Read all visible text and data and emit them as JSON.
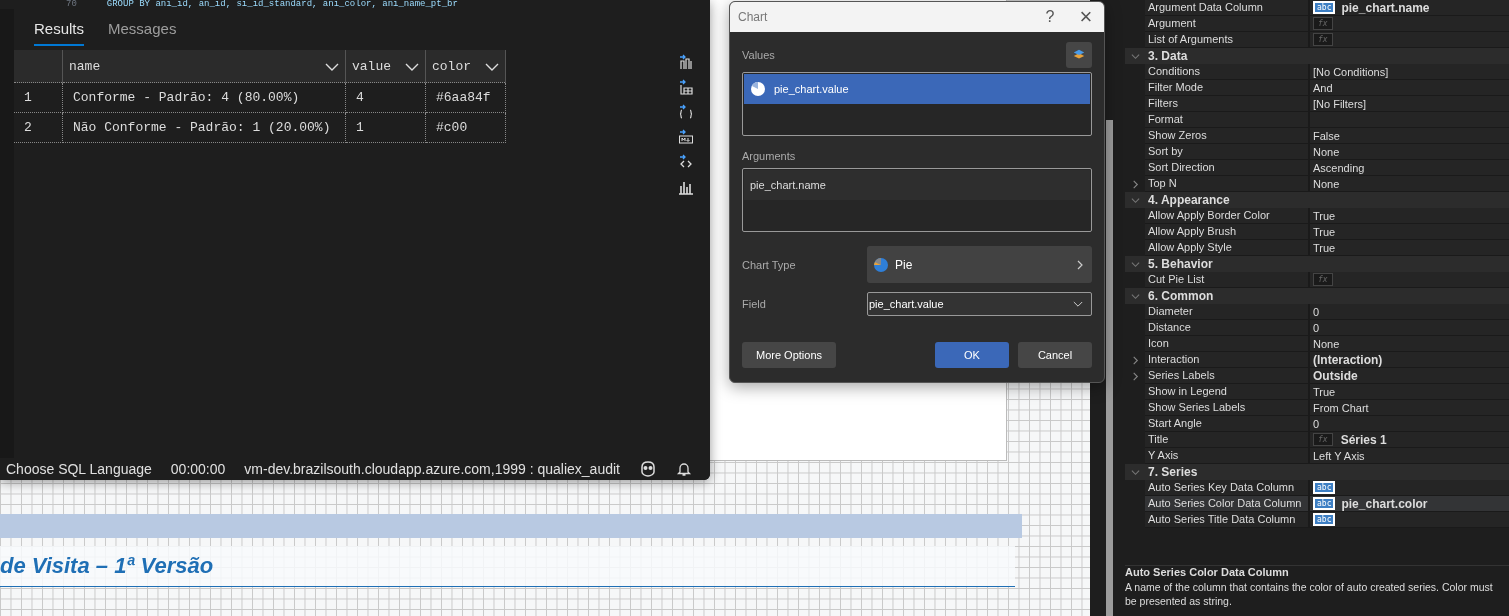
{
  "editor": {
    "line_number": "70",
    "code": "GROUP BY ani_id, an_id, si_id_standard, ani_color, ani_name_pt_br"
  },
  "results": {
    "tabs": [
      {
        "label": "Results",
        "selected": true
      },
      {
        "label": "Messages",
        "selected": false
      }
    ],
    "columns": [
      "name",
      "value",
      "color"
    ],
    "rows": [
      {
        "number": "1",
        "cells": [
          "Conforme - Padrão: 4 (80.00%)",
          "4",
          "#6aa84f"
        ]
      },
      {
        "number": "2",
        "cells": [
          "Não Conforme - Padrão: 1 (20.00%)",
          "1",
          "#c00"
        ]
      }
    ]
  },
  "status_bar": {
    "language": "Choose SQL Language",
    "elapsed": "00:00:00",
    "connection": "vm-dev.brazilsouth.cloudapp.azure.com,1999 : qualiex_audit"
  },
  "designer": {
    "title": "de Visita – 1ª Versão"
  },
  "dialog": {
    "title": "Chart",
    "help": "?",
    "close": "×",
    "values_label": "Values",
    "values": [
      {
        "label": "pie_chart.value",
        "selected": true
      }
    ],
    "arguments_label": "Arguments",
    "arguments": [
      {
        "label": "pie_chart.name",
        "selected": false
      }
    ],
    "chart_type_label": "Chart Type",
    "chart_type": "Pie",
    "field_label": "Field",
    "field": "pie_chart.value",
    "buttons": [
      {
        "label": "More Options",
        "kind": "secondary"
      },
      {
        "label": "OK",
        "kind": "primary"
      },
      {
        "label": "Cancel",
        "kind": "secondary"
      }
    ]
  },
  "properties": {
    "rows": [
      {
        "kind": "property",
        "name": "Argument Data Column",
        "editor": "abc",
        "value": "pie_chart.name",
        "bold": true,
        "selected": false
      },
      {
        "kind": "property",
        "name": "Argument",
        "editor": "fx",
        "selected": false
      },
      {
        "kind": "property",
        "name": "List of Arguments",
        "editor": "fx",
        "selected": false
      },
      {
        "kind": "category",
        "name": "3. Data",
        "expanded": true
      },
      {
        "kind": "property",
        "name": "Conditions",
        "value": "[No Conditions]",
        "bold": false,
        "selected": false
      },
      {
        "kind": "property",
        "name": "Filter Mode",
        "value": "And",
        "bold": false,
        "selected": false
      },
      {
        "kind": "property",
        "name": "Filters",
        "value": "[No Filters]",
        "bold": false,
        "selected": false
      },
      {
        "kind": "property",
        "name": "Format",
        "selected": false
      },
      {
        "kind": "property",
        "name": "Show Zeros",
        "value": "False",
        "bold": false,
        "selected": false
      },
      {
        "kind": "property",
        "name": "Sort by",
        "value": "None",
        "bold": false,
        "selected": false
      },
      {
        "kind": "property",
        "name": "Sort Direction",
        "value": "Ascending",
        "bold": false,
        "selected": false
      },
      {
        "kind": "expandable",
        "name": "Top N",
        "value": "None",
        "bold": false,
        "expanded": false,
        "selected": false
      },
      {
        "kind": "category",
        "name": "4. Appearance",
        "expanded": true
      },
      {
        "kind": "property",
        "name": "Allow Apply Border Color",
        "value": "True",
        "bold": false,
        "selected": false
      },
      {
        "kind": "property",
        "name": "Allow Apply Brush",
        "value": "True",
        "bold": false,
        "selected": false
      },
      {
        "kind": "property",
        "name": "Allow Apply Style",
        "value": "True",
        "bold": false,
        "selected": false
      },
      {
        "kind": "category",
        "name": "5. Behavior",
        "expanded": true
      },
      {
        "kind": "property",
        "name": "Cut Pie List",
        "editor": "fx",
        "selected": false
      },
      {
        "kind": "category",
        "name": "6. Common",
        "expanded": true
      },
      {
        "kind": "property",
        "name": "Diameter",
        "value": "0",
        "bold": false,
        "selected": false
      },
      {
        "kind": "property",
        "name": "Distance",
        "value": "0",
        "bold": false,
        "selected": false
      },
      {
        "kind": "property",
        "name": "Icon",
        "value": "None",
        "bold": false,
        "selected": false
      },
      {
        "kind": "expandable",
        "name": "Interaction",
        "value": "(Interaction)",
        "bold": true,
        "expanded": false,
        "selected": false
      },
      {
        "kind": "expandable",
        "name": "Series Labels",
        "value": "Outside",
        "bold": true,
        "expanded": false,
        "selected": false
      },
      {
        "kind": "property",
        "name": "Show in Legend",
        "value": "True",
        "bold": false,
        "selected": false
      },
      {
        "kind": "property",
        "name": "Show Series Labels",
        "value": "From Chart",
        "bold": false,
        "selected": false
      },
      {
        "kind": "property",
        "name": "Start Angle",
        "value": "0",
        "bold": false,
        "selected": false
      },
      {
        "kind": "property",
        "name": "Title",
        "editor": "fx",
        "value": "Séries 1",
        "bold": true,
        "selected": false
      },
      {
        "kind": "property",
        "name": "Y Axis",
        "value": "Left Y Axis",
        "bold": false,
        "selected": false
      },
      {
        "kind": "category",
        "name": "7. Series",
        "expanded": true
      },
      {
        "kind": "property",
        "name": "Auto Series Key Data Column",
        "editor": "abc",
        "selected": false
      },
      {
        "kind": "property",
        "name": "Auto Series Color Data Column",
        "editor": "abc",
        "value": "pie_chart.color",
        "bold": true,
        "selected": true
      },
      {
        "kind": "property",
        "name": "Auto Series Title Data Column",
        "editor": "abc",
        "selected": false
      }
    ],
    "description_title": "Auto Series Color Data Column",
    "description": "A name of the column that contains the color of auto created series. Color must be presented as string."
  }
}
